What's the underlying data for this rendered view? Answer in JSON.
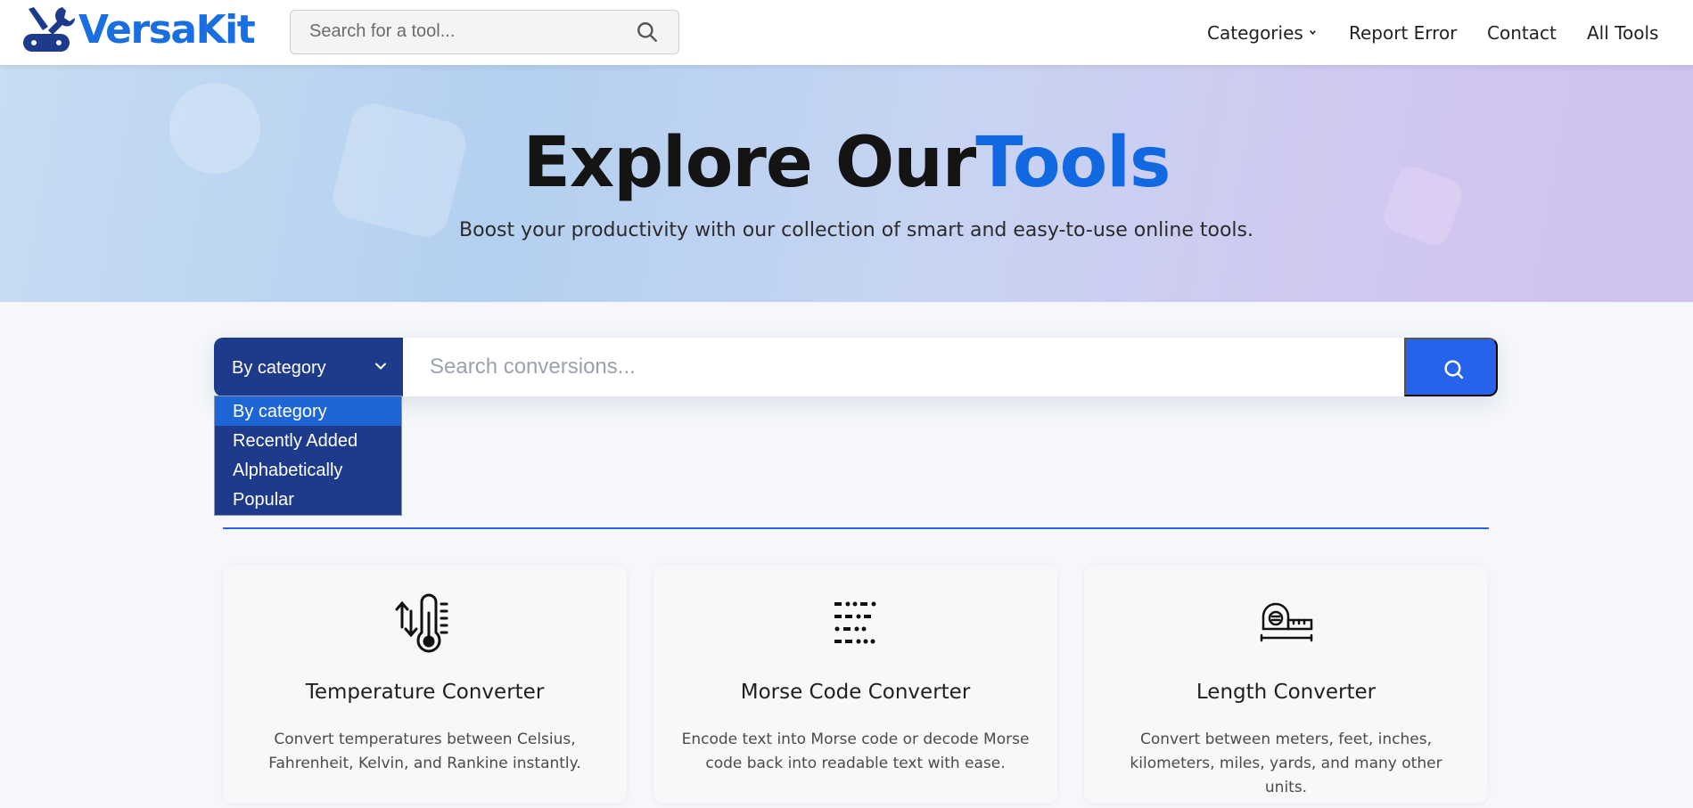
{
  "brand": {
    "name": "VersaKit"
  },
  "top_search": {
    "placeholder": "Search for a tool..."
  },
  "nav": {
    "categories": "Categories",
    "report_error": "Report Error",
    "contact": "Contact",
    "all_tools": "All Tools"
  },
  "hero": {
    "title_main": "Explore Our",
    "title_accent": "Tools",
    "subtitle": "Boost your productivity with our collection of smart and easy-to-use online tools."
  },
  "filter": {
    "selected": "By category",
    "options": [
      "By category",
      "Recently Added",
      "Alphabetically",
      "Popular"
    ],
    "search_placeholder": "Search conversions..."
  },
  "cards": [
    {
      "icon": "thermometer-icon",
      "title": "Temperature Converter",
      "description": "Convert temperatures between Celsius, Fahrenheit, Kelvin, and Rankine instantly."
    },
    {
      "icon": "morse-code-icon",
      "title": "Morse Code Converter",
      "description": "Encode text into Morse code or decode Morse code back into readable text with ease."
    },
    {
      "icon": "tape-measure-icon",
      "title": "Length Converter",
      "description": "Convert between meters, feet, inches, kilometers, miles, yards, and many other units."
    }
  ],
  "colors": {
    "brand_blue": "#1a6fe0",
    "navy": "#1e3a8a",
    "accent": "#2563eb"
  }
}
